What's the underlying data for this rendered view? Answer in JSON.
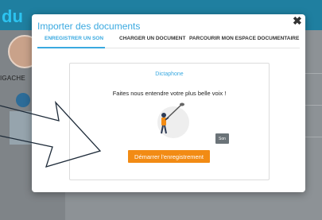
{
  "background": {
    "logo": "du",
    "user_name": "IGACHE"
  },
  "modal": {
    "title": "Importer des documents",
    "close_symbol": "✖",
    "tabs": [
      {
        "label": "ENREGISTRER UN SON",
        "active": true
      },
      {
        "label": "CHARGER UN DOCUMENT",
        "active": false
      },
      {
        "label": "PARCOURIR MON ESPACE DOCUMENTAIRE",
        "active": false
      }
    ],
    "dictaphone": {
      "title": "Dictaphone",
      "subtitle": "Faites nous entendre votre plus belle voix !",
      "illustration_icon": "person-with-microphone-icon",
      "badge": "Son",
      "record_button": "Démarrer l'enregistrement"
    }
  },
  "colors": {
    "accent": "#3aa9e0",
    "record_button": "#f28b14",
    "header": "#1f7fa0"
  }
}
